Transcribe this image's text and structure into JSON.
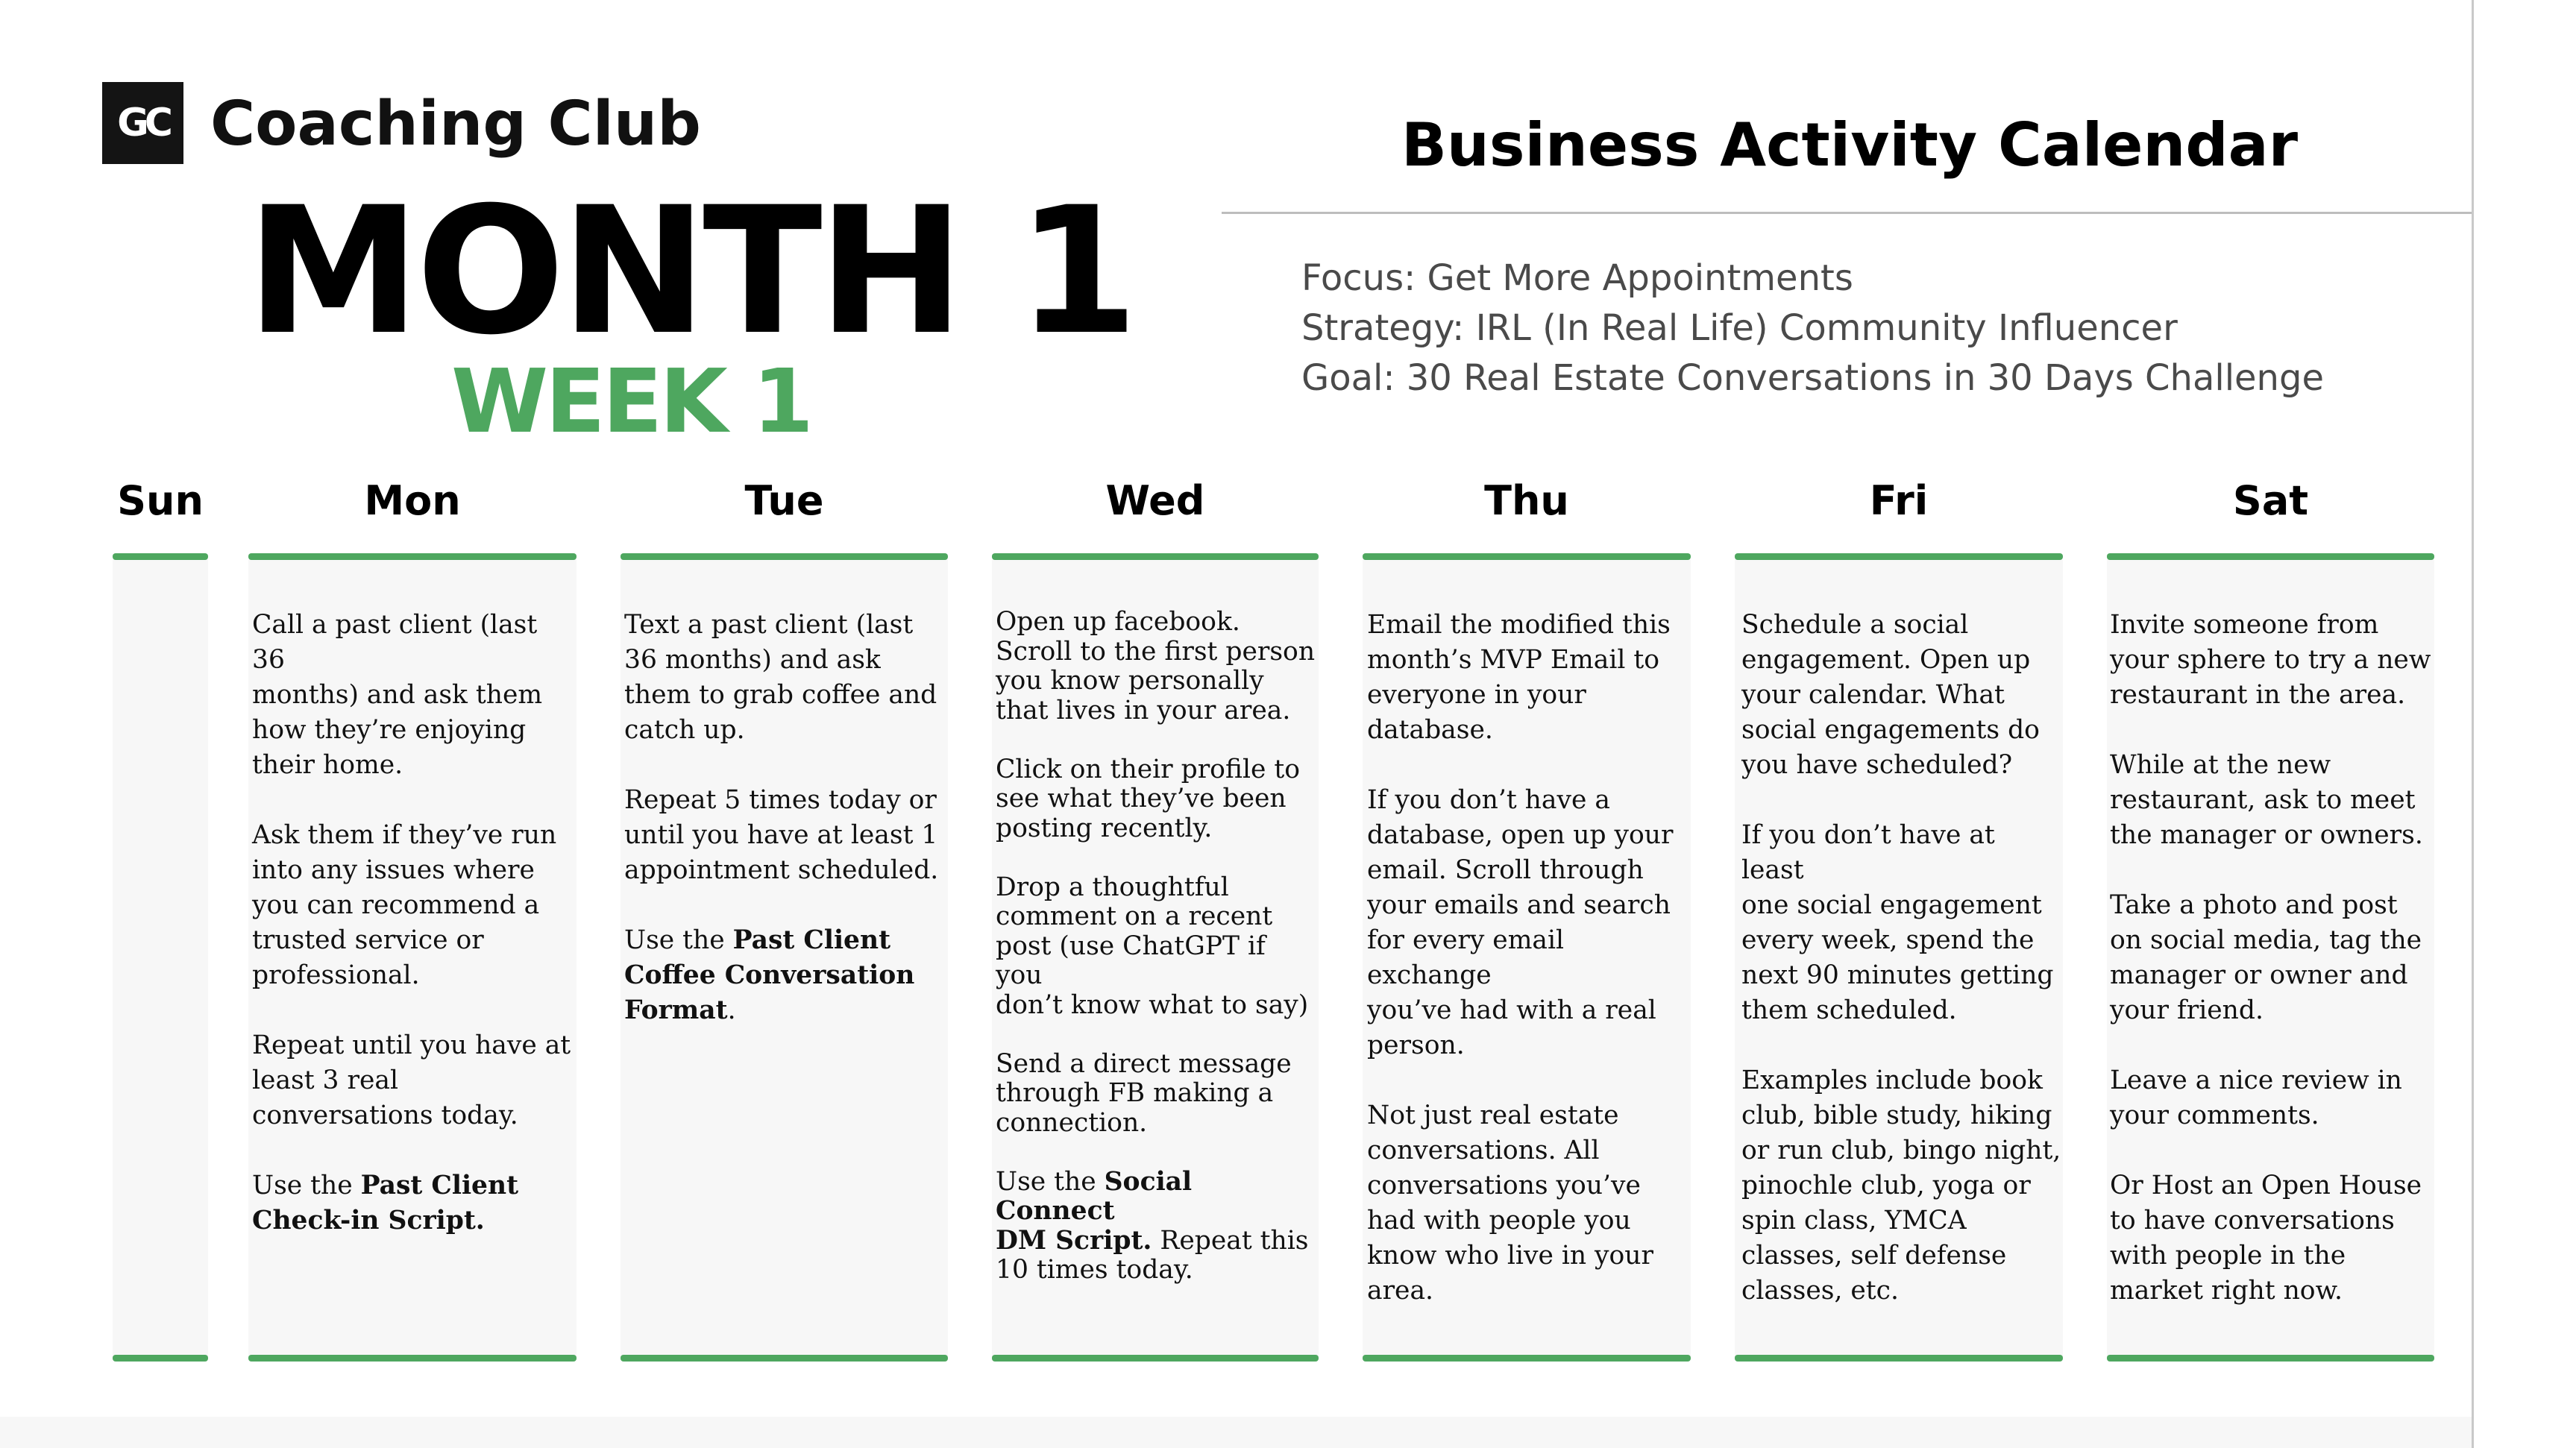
{
  "brand": {
    "logo_text": "GC",
    "name": "Coaching Club"
  },
  "heading": {
    "month": "MONTH 1",
    "week": "WEEK 1"
  },
  "calendar_title": "Business Activity Calendar",
  "info": {
    "focus": "Focus: Get More Appointments",
    "strategy": "Strategy: IRL (In Real Life) Community Influencer",
    "goal": "Goal: 30 Real Estate Conversations in 30 Days Challenge"
  },
  "colors": {
    "accent_green": "#4ea75f",
    "column_bg": "#f7f7f7",
    "text_dark": "#111111",
    "info_text": "#4a4a4a"
  },
  "days": {
    "sun": "Sun",
    "mon": "Mon",
    "tue": "Tue",
    "wed": "Wed",
    "thu": "Thu",
    "fri": "Fri",
    "sat": "Sat"
  },
  "activities": {
    "mon": {
      "p1": "Call a past client (last 36\nmonths) and ask them\nhow they’re enjoying\ntheir home.",
      "p2": "Ask them if they’ve run\ninto any issues where\nyou can recommend a\ntrusted service or\nprofessional.",
      "p3": "Repeat until you have at\nleast 3 real\nconversations today.",
      "p4_pre": "Use the ",
      "p4_bold": "Past Client\nCheck-in Script."
    },
    "tue": {
      "p1": "Text a past client (last\n36 months) and ask\nthem to grab coffee and\ncatch up.",
      "p2": "Repeat 5 times today or\nuntil you have at least 1\nappointment scheduled.",
      "p3_pre": "Use the ",
      "p3_bold": "Past Client\nCoffee Conversation\nFormat",
      "p3_post": "."
    },
    "wed": {
      "p1": "Open up facebook.\nScroll to the first person\nyou know personally\nthat lives in your area.",
      "p2": "Click on their profile to\nsee what they’ve been\nposting recently.",
      "p3": "Drop a thoughtful\ncomment on a recent\npost (use ChatGPT if you\ndon’t know what to say)",
      "p4": "Send a direct message\nthrough FB making a\nconnection.",
      "p5_pre": "Use the ",
      "p5_bold": "Social Connect\nDM Script.",
      "p5_post": " Repeat this\n10 times today."
    },
    "thu": {
      "p1": "Email the modified this\nmonth’s MVP Email to\neveryone in your\ndatabase.",
      "p2": "If you don’t have a\ndatabase, open up your\nemail. Scroll through\nyour emails and search\nfor every email exchange\nyou’ve had with a real\nperson.",
      "p3": "Not just real estate\nconversations. All\nconversations you’ve\nhad with people you\nknow who live in your\narea."
    },
    "fri": {
      "p1": "Schedule a social\nengagement. Open up\nyour calendar. What\nsocial engagements do\nyou have scheduled?",
      "p2": "If you don’t have at least\none social engagement\nevery week, spend the\nnext 90 minutes getting\nthem scheduled.",
      "p3": "Examples include book\nclub, bible study, hiking\nor run club, bingo night,\npinochle club, yoga or\nspin class, YMCA\nclasses, self defense\nclasses, etc."
    },
    "sat": {
      "p1": "Invite someone from\nyour sphere to try a new\nrestaurant in the area.",
      "p2": "While at the new\nrestaurant, ask to meet\nthe manager or owners.",
      "p3": "Take a photo and post\non social media, tag the\nmanager or owner and\nyour friend.",
      "p4": "Leave a nice review in\nyour comments.",
      "p5": "Or Host an Open House\nto have conversations\nwith people in the\nmarket right now."
    }
  }
}
